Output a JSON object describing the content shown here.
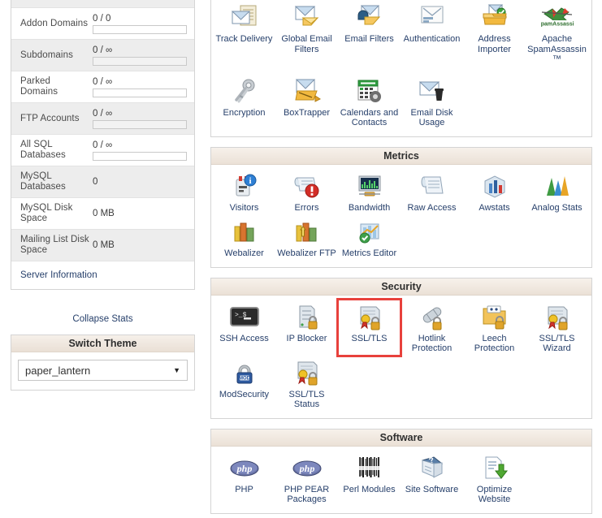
{
  "theme": {
    "accent_red": "#e8413c",
    "link_color": "#27406b",
    "header_bg": "#f0e8e0",
    "border": "#d4d4d4"
  },
  "sidebar": {
    "stats": [
      {
        "label": "Addon Domains",
        "value": "0 / 0",
        "has_bar": true,
        "shaded": false
      },
      {
        "label": "Subdomains",
        "value": "0 / ∞",
        "has_bar": true,
        "shaded": true
      },
      {
        "label": "Parked Domains",
        "value": "0 / ∞",
        "has_bar": true,
        "shaded": false
      },
      {
        "label": "FTP Accounts",
        "value": "0 / ∞",
        "has_bar": true,
        "shaded": true
      },
      {
        "label": "All SQL Databases",
        "value": "0 / ∞",
        "has_bar": true,
        "shaded": false
      },
      {
        "label": "MySQL Databases",
        "value": "0",
        "has_bar": false,
        "shaded": true
      },
      {
        "label": "MySQL Disk Space",
        "value": "0 MB",
        "has_bar": false,
        "shaded": false
      },
      {
        "label": "Mailing List Disk Space",
        "value": "0 MB",
        "has_bar": false,
        "shaded": true
      }
    ],
    "server_information": "Server Information",
    "collapse_stats": "Collapse Stats",
    "switch_theme": {
      "title": "Switch Theme",
      "selected": "paper_lantern",
      "options": [
        "paper_lantern"
      ]
    }
  },
  "main": {
    "email_group": {
      "row1": [
        {
          "label": "Track Delivery",
          "icon": "track-delivery-icon"
        },
        {
          "label": "Global Email Filters",
          "icon": "global-email-filters-icon"
        },
        {
          "label": "Email Filters",
          "icon": "email-filters-icon"
        },
        {
          "label": "Authentication",
          "icon": "authentication-icon"
        },
        {
          "label": "Address Importer",
          "icon": "address-importer-icon"
        },
        {
          "label": "Apache SpamAssassin™",
          "icon": "spamassassin-icon"
        }
      ],
      "row2": [
        {
          "label": "Encryption",
          "icon": "encryption-key-icon"
        },
        {
          "label": "BoxTrapper",
          "icon": "boxtrapper-icon"
        },
        {
          "label": "Calendars and Contacts",
          "icon": "calendars-contacts-icon"
        },
        {
          "label": "Email Disk Usage",
          "icon": "email-disk-usage-icon"
        }
      ]
    },
    "metrics": {
      "title": "Metrics",
      "items": [
        {
          "label": "Visitors",
          "icon": "visitors-icon"
        },
        {
          "label": "Errors",
          "icon": "errors-icon"
        },
        {
          "label": "Bandwidth",
          "icon": "bandwidth-icon"
        },
        {
          "label": "Raw Access",
          "icon": "raw-access-icon"
        },
        {
          "label": "Awstats",
          "icon": "awstats-icon"
        },
        {
          "label": "Analog Stats",
          "icon": "analog-stats-icon"
        },
        {
          "label": "Webalizer",
          "icon": "webalizer-icon"
        },
        {
          "label": "Webalizer FTP",
          "icon": "webalizer-ftp-icon"
        },
        {
          "label": "Metrics Editor",
          "icon": "metrics-editor-icon"
        }
      ]
    },
    "security": {
      "title": "Security",
      "items": [
        {
          "label": "SSH Access",
          "icon": "ssh-terminal-icon",
          "highlighted": false
        },
        {
          "label": "IP Blocker",
          "icon": "ip-blocker-icon",
          "highlighted": false
        },
        {
          "label": "SSL/TLS",
          "icon": "ssl-tls-icon",
          "highlighted": true
        },
        {
          "label": "Hotlink Protection",
          "icon": "hotlink-protection-icon",
          "highlighted": false
        },
        {
          "label": "Leech Protection",
          "icon": "leech-protection-icon",
          "highlighted": false
        },
        {
          "label": "SSL/TLS Wizard",
          "icon": "ssl-tls-wizard-icon",
          "highlighted": false
        },
        {
          "label": "ModSecurity",
          "icon": "modsecurity-icon",
          "highlighted": false
        },
        {
          "label": "SSL/TLS Status",
          "icon": "ssl-tls-status-icon",
          "highlighted": false
        }
      ]
    },
    "software": {
      "title": "Software",
      "items": [
        {
          "label": "PHP",
          "icon": "php-icon"
        },
        {
          "label": "PHP PEAR Packages",
          "icon": "php-pear-icon"
        },
        {
          "label": "Perl Modules",
          "icon": "perl-modules-icon"
        },
        {
          "label": "Site Software",
          "icon": "site-software-icon"
        },
        {
          "label": "Optimize Website",
          "icon": "optimize-website-icon"
        }
      ]
    }
  }
}
